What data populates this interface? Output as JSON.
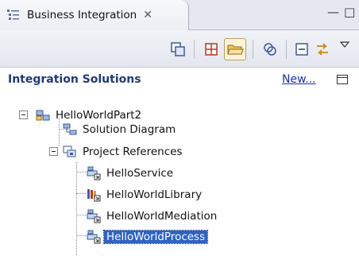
{
  "view": {
    "tab_label": "Business Integration",
    "tab_close_glyph": "✕",
    "minimize_glyph": "—",
    "maximize_glyph": "□"
  },
  "toolbar": {
    "buttons": [
      {
        "name": "link-editor-icon",
        "active": false
      },
      {
        "name": "show-categories-icon",
        "active": false
      },
      {
        "name": "open-folder-icon",
        "active": true
      },
      {
        "name": "sync-icon",
        "active": false
      },
      {
        "name": "collapse-all-icon",
        "active": false
      },
      {
        "name": "swap-arrows-icon",
        "active": false
      },
      {
        "name": "view-menu-icon",
        "active": false
      }
    ]
  },
  "section": {
    "title": "Integration Solutions",
    "new_link": "New..."
  },
  "tree": {
    "root": {
      "label": "HelloWorldPart2",
      "icon": "solution-icon",
      "expanded": true
    },
    "children": [
      {
        "label": "Solution Diagram",
        "icon": "diagram-icon"
      },
      {
        "label": "Project References",
        "icon": "references-icon",
        "expanded": true
      }
    ],
    "references": [
      {
        "label": "HelloService",
        "icon": "module-icon",
        "selected": false
      },
      {
        "label": "HelloWorldLibrary",
        "icon": "library-icon",
        "selected": false
      },
      {
        "label": "HelloWorldMediation",
        "icon": "module-icon",
        "selected": false
      },
      {
        "label": "HelloWorldProcess",
        "icon": "module-icon",
        "selected": true
      }
    ]
  },
  "colors": {
    "selection": "#2d63c6",
    "section_title": "#1f3a78",
    "link": "#1a2fb8"
  }
}
